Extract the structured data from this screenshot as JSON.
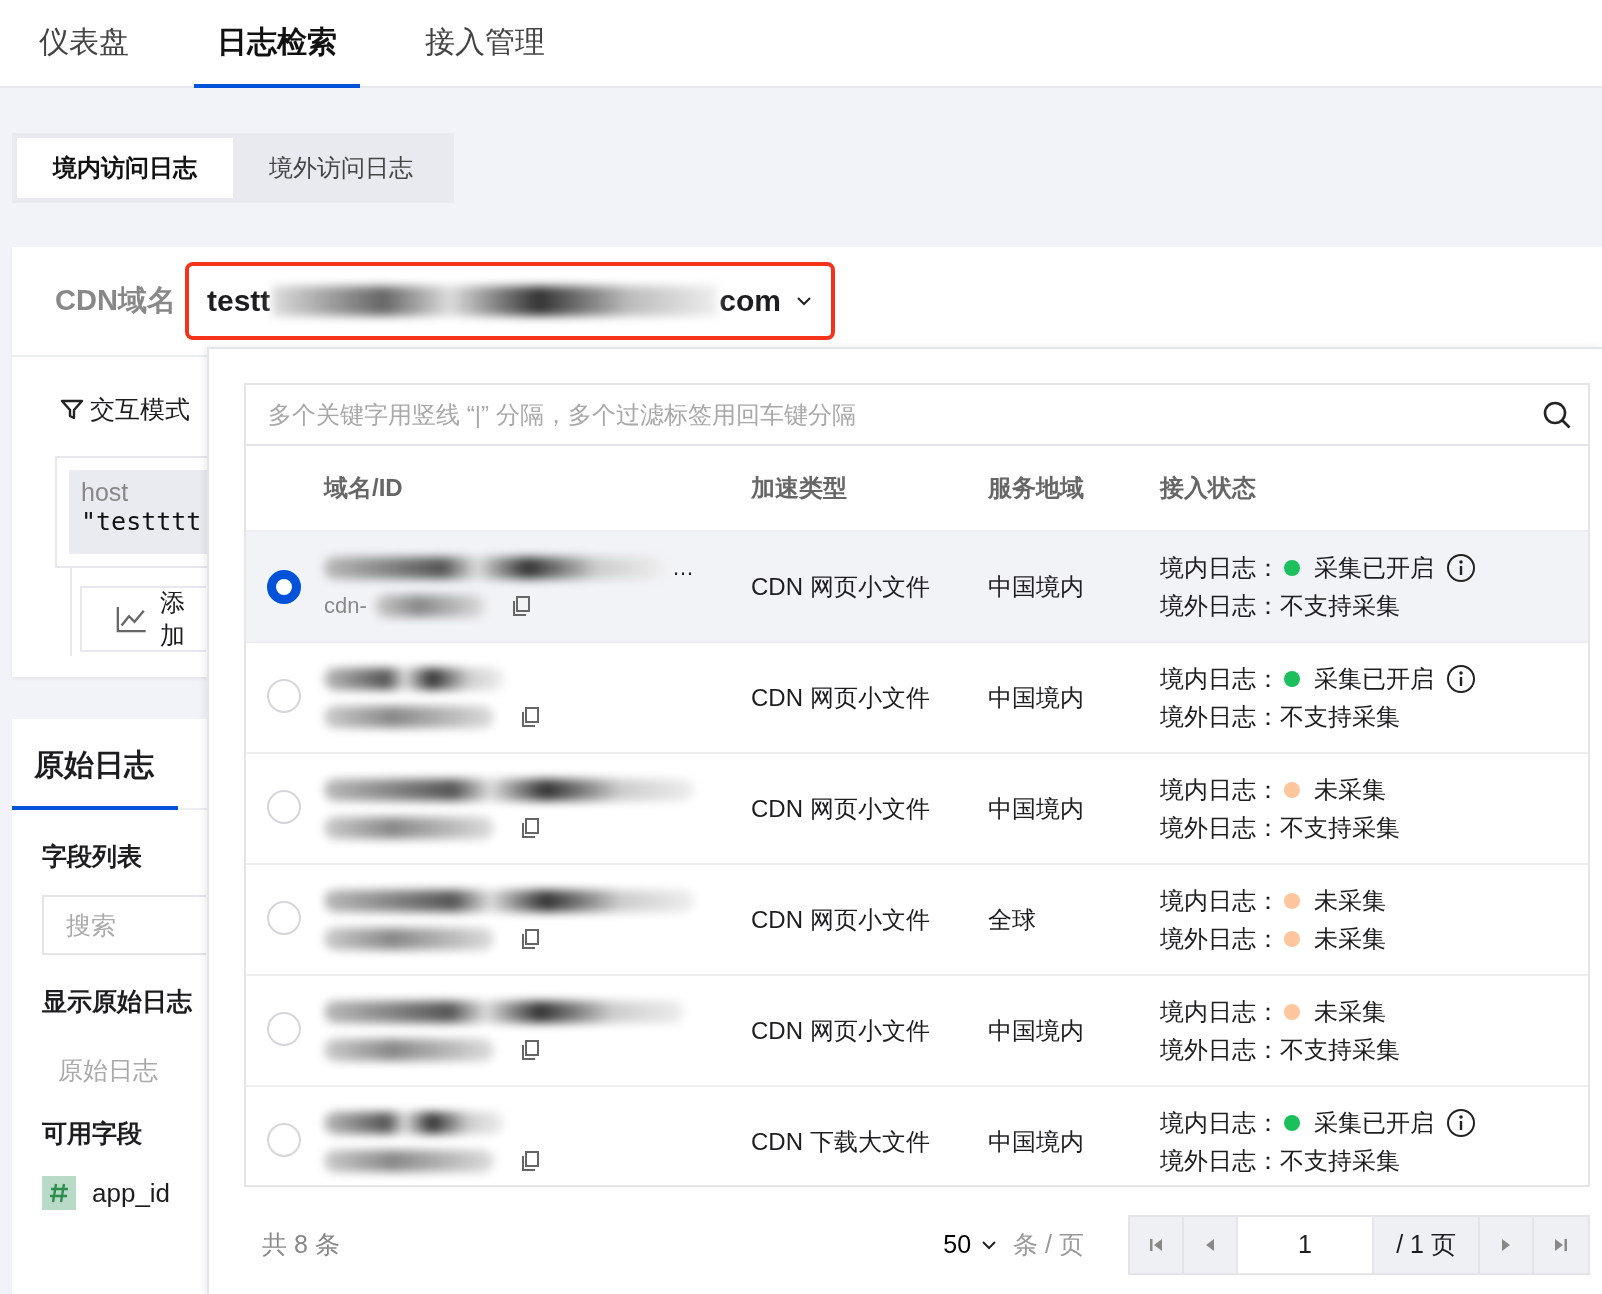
{
  "top_tabs": [
    {
      "label": "仪表盘",
      "selected": false
    },
    {
      "label": "日志检索",
      "selected": true
    },
    {
      "label": "接入管理",
      "selected": false
    }
  ],
  "log_tabs": [
    {
      "label": "境内访问日志",
      "selected": true
    },
    {
      "label": "境外访问日志",
      "selected": false
    }
  ],
  "domain_select": {
    "label": "CDN域名",
    "value_start": "testt",
    "value_end": "com"
  },
  "query": {
    "mode": "交互模式",
    "field": "host",
    "value": "\"testttt",
    "add": "添加"
  },
  "side": {
    "tab": "原始日志",
    "fields_title": "字段列表",
    "search_placeholder": "搜索",
    "raw_title": "显示原始日志",
    "raw_item": "原始日志",
    "available_title": "可用字段",
    "fields": [
      {
        "name": "app_id"
      }
    ]
  },
  "popup": {
    "search_placeholder": "多个关键字用竖线 “|” 分隔，多个过滤标签用回车键分隔",
    "columns": [
      "域名/ID",
      "加速类型",
      "服务地域",
      "接入状态"
    ],
    "rows": [
      {
        "selected": true,
        "tail": "…",
        "id_head": "cdn-",
        "type": "CDN 网页小文件",
        "region": "中国境内",
        "status": [
          {
            "label": "境内日志：",
            "color": "#1bbf5b",
            "text": "采集已开启",
            "info": true
          },
          {
            "label": "境外日志：",
            "text": "不支持采集"
          }
        ]
      },
      {
        "selected": false,
        "type": "CDN 网页小文件",
        "region": "中国境内",
        "status": [
          {
            "label": "境内日志：",
            "color": "#1bbf5b",
            "text": "采集已开启",
            "info": true
          },
          {
            "label": "境外日志：",
            "text": "不支持采集"
          }
        ]
      },
      {
        "selected": false,
        "type": "CDN 网页小文件",
        "region": "中国境内",
        "status": [
          {
            "label": "境内日志：",
            "color": "#ffc59c",
            "text": "未采集"
          },
          {
            "label": "境外日志：",
            "text": "不支持采集"
          }
        ]
      },
      {
        "selected": false,
        "type": "CDN 网页小文件",
        "region": "全球",
        "status": [
          {
            "label": "境内日志：",
            "color": "#ffc59c",
            "text": "未采集"
          },
          {
            "label": "境外日志：",
            "color": "#ffc59c",
            "text": "未采集"
          }
        ]
      },
      {
        "selected": false,
        "type": "CDN 网页小文件",
        "region": "中国境内",
        "status": [
          {
            "label": "境内日志：",
            "color": "#ffc59c",
            "text": "未采集"
          },
          {
            "label": "境外日志：",
            "text": "不支持采集"
          }
        ]
      },
      {
        "selected": false,
        "type": "CDN 下载大文件",
        "region": "中国境内",
        "status": [
          {
            "label": "境内日志：",
            "color": "#1bbf5b",
            "text": "采集已开启",
            "info": true
          },
          {
            "label": "境外日志：",
            "text": "不支持采集"
          }
        ]
      }
    ],
    "total": "共 8 条",
    "page_size": "50",
    "page_size_unit": "条 / 页",
    "page": "1",
    "pages": "/ 1 页"
  }
}
